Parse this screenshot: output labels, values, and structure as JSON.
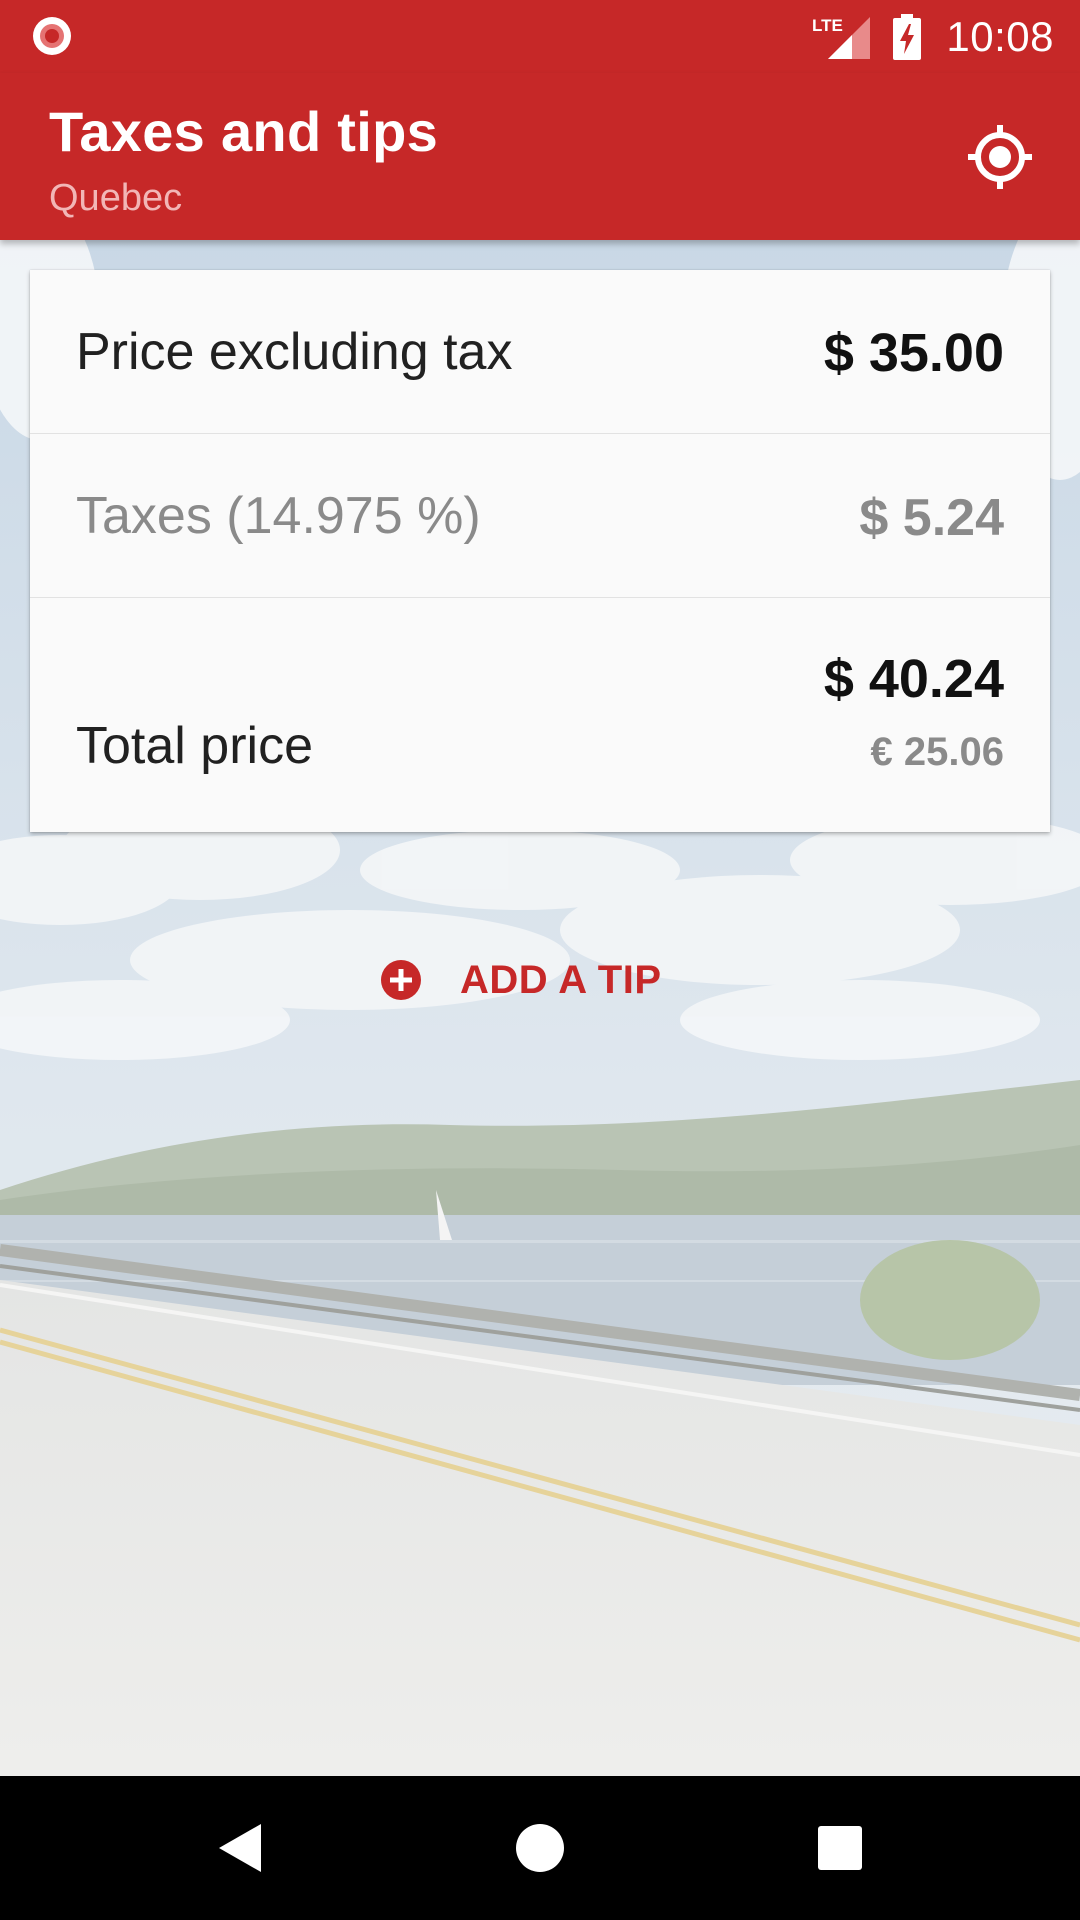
{
  "status_bar": {
    "time": "10:08",
    "network": "LTE",
    "icons": [
      "record-icon",
      "lte-signal-icon",
      "battery-charging-icon"
    ]
  },
  "app_bar": {
    "title": "Taxes and tips",
    "subtitle": "Quebec",
    "action_icon": "locate-icon"
  },
  "summary": {
    "price_label": "Price excluding tax",
    "price_value": "$ 35.00",
    "tax_label": "Taxes (14.975 %)",
    "tax_value": "$ 5.24",
    "total_label": "Total price",
    "total_value": "$ 40.24",
    "total_converted": "€ 25.06"
  },
  "tip": {
    "label": "ADD A TIP",
    "icon": "add-circle-icon"
  },
  "nav_bar": {
    "icons": [
      "back-icon",
      "home-icon",
      "recents-icon"
    ]
  },
  "colors": {
    "primary": "#c62828",
    "subtitle": "#f2b6b6",
    "card": "#fafafa",
    "muted_text": "#8a8a8a"
  }
}
